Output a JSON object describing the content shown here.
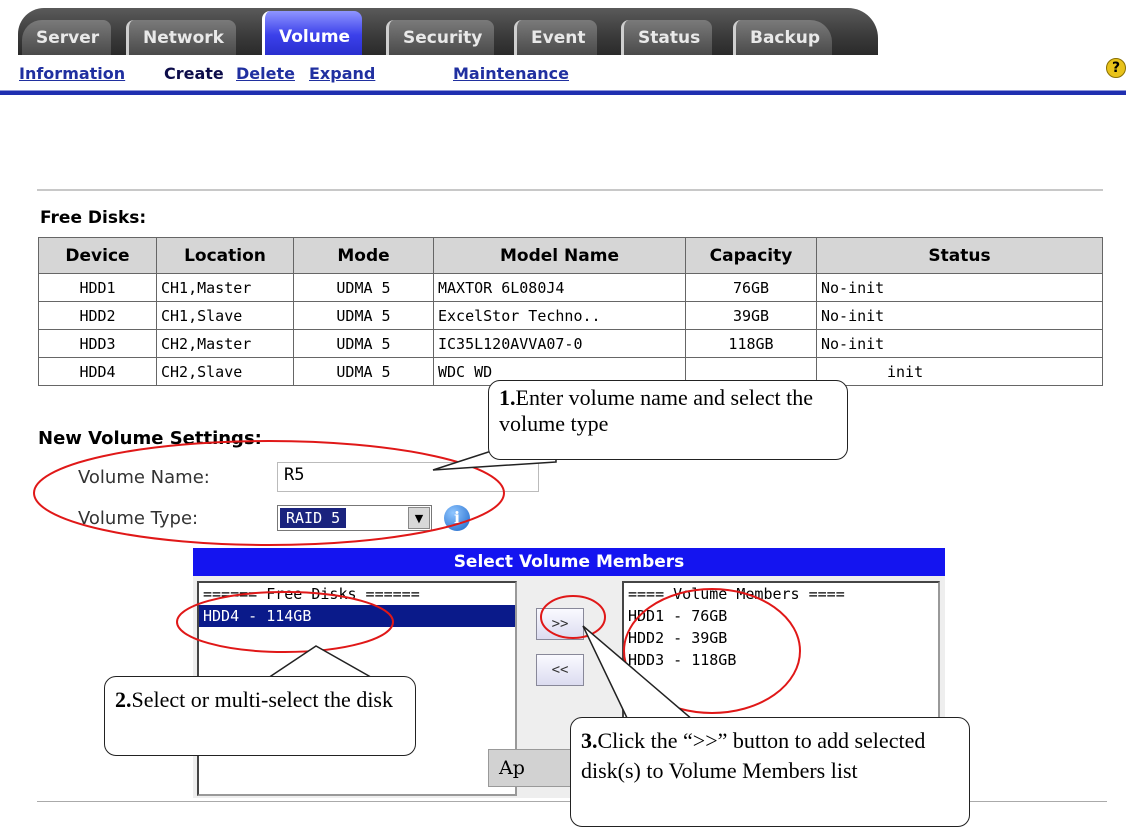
{
  "nav": {
    "tabs": [
      {
        "label": "Server"
      },
      {
        "label": "Network"
      },
      {
        "label": "Volume"
      },
      {
        "label": "Security"
      },
      {
        "label": "Event"
      },
      {
        "label": "Status"
      },
      {
        "label": "Backup"
      }
    ],
    "subnav": [
      {
        "label": "Information"
      },
      {
        "label": "Create"
      },
      {
        "label": "Delete"
      },
      {
        "label": "Expand"
      },
      {
        "label": "Maintenance"
      }
    ],
    "help_icon": "?"
  },
  "free_disks": {
    "title": "Free Disks:",
    "columns": [
      "Device",
      "Location",
      "Mode",
      "Model Name",
      "Capacity",
      "Status"
    ],
    "rows": [
      [
        "HDD1",
        "CH1,Master",
        "UDMA 5",
        "MAXTOR 6L080J4",
        "76GB",
        "No-init"
      ],
      [
        "HDD2",
        "CH1,Slave",
        "UDMA 5",
        "ExcelStor Techno..",
        "39GB",
        "No-init"
      ],
      [
        "HDD3",
        "CH2,Master",
        "UDMA 5",
        "IC35L120AVVA07-0",
        "118GB",
        "No-init"
      ],
      [
        "HDD4",
        "CH2,Slave",
        "UDMA 5",
        "WDC WD",
        "",
        "init"
      ]
    ]
  },
  "settings": {
    "title": "New Volume Settings:",
    "volume_name_label": "Volume Name:",
    "volume_name_value": "R5",
    "volume_type_label": "Volume Type:",
    "volume_type_value": "RAID 5"
  },
  "members": {
    "header": "Select Volume Members",
    "free_list": [
      "====== Free Disks ======",
      "HDD4 - 114GB"
    ],
    "member_list": [
      "==== Volume Members ====",
      "HDD1 - 76GB",
      "HDD2 - 39GB",
      "HDD3 - 118GB"
    ],
    "add_label": ">>",
    "remove_label": "<<"
  },
  "apply_label": "Ap",
  "callouts": {
    "c1": {
      "num": "1.",
      "text": "Enter volume name and select the volume type"
    },
    "c2": {
      "num": "2.",
      "text": "Select or multi-select the disk"
    },
    "c3": {
      "num": "3.",
      "text": "Click the “>>” button to add selected disk(s) to Volume Members list"
    }
  },
  "colors": {
    "accent": "#1414f0",
    "subnav_bar": "#1f2fb0",
    "annotation": "#e01818"
  }
}
